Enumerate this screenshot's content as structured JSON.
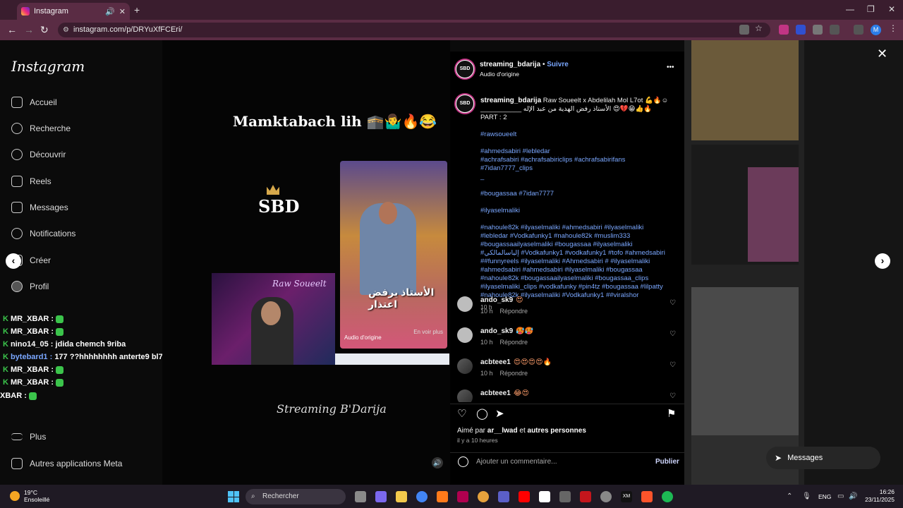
{
  "browser": {
    "tab_title": "Instagram",
    "new_tab": "+",
    "url": "instagram.com/p/DRYuXfFCEri/",
    "window": {
      "minimize": "—",
      "restore": "❐",
      "close": "✕"
    }
  },
  "sidebar": {
    "logo": "Instagram",
    "items": [
      {
        "label": "Accueil",
        "icon": "home-icon"
      },
      {
        "label": "Recherche",
        "icon": "search-icon"
      },
      {
        "label": "Découvrir",
        "icon": "compass-icon"
      },
      {
        "label": "Reels",
        "icon": "reels-icon"
      },
      {
        "label": "Messages",
        "icon": "messages-icon"
      },
      {
        "label": "Notifications",
        "icon": "heart-icon"
      },
      {
        "label": "Créer",
        "icon": "plus-icon"
      },
      {
        "label": "Profil",
        "icon": "avatar-icon"
      }
    ],
    "more": "Plus",
    "meta": "Autres applications Meta"
  },
  "chat_overlay": [
    {
      "user": "MR_XBAR :",
      "text": ""
    },
    {
      "user": "MR_XBAR :",
      "text": ""
    },
    {
      "user": "nino14_05 :",
      "text": "jdida chemch 9riba"
    },
    {
      "user": "bytebard1 :",
      "text": "177 ??hhhhhhhh anterte9 bl7sed"
    },
    {
      "user": "MR_XBAR :",
      "text": ""
    },
    {
      "user": "MR_XBAR :",
      "text": ""
    },
    {
      "user": "XBAR :",
      "text": ""
    }
  ],
  "video": {
    "title": "Mamktabach lih 🕋🤷‍♂️🔥😂",
    "logo": "SBD",
    "clip1_overlay": "الأستاذ يرفض اعتذار",
    "clip1_caption": "Audio d'origine",
    "clip1_more": "En voir plus",
    "clip2_title": "Raw Soueelt",
    "signature": "Streaming B'Darija",
    "mute": "🔊"
  },
  "post": {
    "author": "streaming_bdarija",
    "follow": "Suivre",
    "audio": "Audio d'origine",
    "more_menu": "•••",
    "avatar_text": "SBD",
    "caption_title": "Raw Soueelt x Abdelilah Mol L7ot 💪🔥☺ ___________ الأستاذ رفض الهدية من عبد الإله 😍💔😁👍🔥 PART : 2",
    "hashtags": [
      "#rawsoueelt",
      "#ahmedsabiri #lebledar\n#achrafsabiri #achrafsabiriclips #achrafsabirifans #7idan7777_clips\n_",
      "#bougassaa #7idan7777",
      "#ilyaselmaliki",
      "#nahoule82k #ilyaselmaliki #ahmedsabiri #ilyaselmaliki #lebledar #Vodkafunky1 #nahoule82k #muslim333 #bougassaailyaselmaliki #bougassaa #ilyaselmaliki #إلياسالمالكي #Vodkafunky1 #vodkafunky1 #tofo #ahmedsabiri ##funnyreels #ilyaselmaliki #Ahmedsabiri # #ilyaselmaliki #ahmedsabiri #ahmedsabiri #ilyaselmaliki #bougassaa #nahoule82k #bougassaailyaselmaliki #bougassaa_clips #ilyaselmaliki_clips #vodkafunky #pin4tz #bougassaa #lilpatty #nahoule82k #ilyaselmaliki #Vodkafunky1 ##viralshor"
    ],
    "caption_time": "10 h",
    "comments": [
      {
        "user": "ando_sk9",
        "emoji": "😍",
        "time": "10 h",
        "reply": "Répondre"
      },
      {
        "user": "ando_sk9",
        "emoji": "🥵🥵",
        "time": "10 h",
        "reply": "Répondre"
      },
      {
        "user": "acbteee1",
        "emoji": "😍😍😍😍🔥",
        "time": "10 h",
        "reply": "Répondre"
      },
      {
        "user": "acbteee1",
        "emoji": "😂😍",
        "time": "",
        "reply": ""
      }
    ],
    "likes_prefix": "Aimé par",
    "likes_user": "ar__lwad",
    "likes_and": "et",
    "likes_others": "autres personnes",
    "posted_ago": "il y a 10 heures",
    "add_comment_placeholder": "Ajouter un commentaire...",
    "publish": "Publier"
  },
  "messages_button": "Messages",
  "taskbar": {
    "temperature": "19°C",
    "weather": "Ensoleillé",
    "search": "Rechercher",
    "lang": "ENG",
    "time": "16:26",
    "date": "23/11/2025"
  },
  "colors": {
    "accent": "#5a2c44",
    "link": "#7aa7ff",
    "panel": "#000000"
  }
}
